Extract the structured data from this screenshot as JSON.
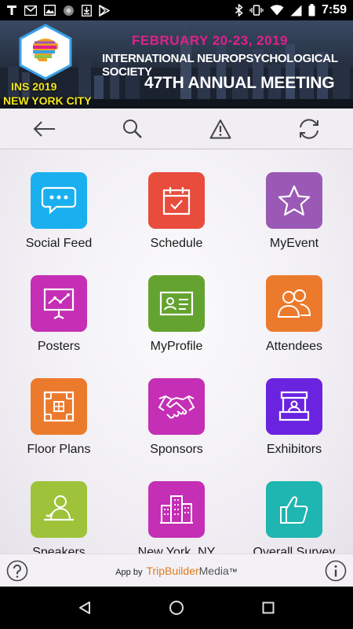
{
  "status_bar": {
    "time": "7:59",
    "icons": [
      "t-icon",
      "gmail-icon",
      "image-icon",
      "circle-icon",
      "download-icon",
      "play-store-icon",
      "bluetooth-icon",
      "vibrate-icon",
      "wifi-icon",
      "signal-icon",
      "battery-icon"
    ]
  },
  "banner": {
    "date": "FEBRUARY 20-23, 2019",
    "society": "INTERNATIONAL NEUROPSYCHOLOGICAL SOCIETY",
    "meeting": "47TH ANNUAL MEETING",
    "event_tag": "INS 2019",
    "city": "NEW YORK CITY"
  },
  "toolbar": {
    "buttons": [
      "back-arrow-icon",
      "search-icon",
      "alert-icon",
      "sync-icon"
    ]
  },
  "tiles": [
    {
      "label": "Social Feed",
      "icon": "chat-bubbles-icon",
      "color": "#1ab0f0"
    },
    {
      "label": "Schedule",
      "icon": "calendar-check-icon",
      "color": "#e84c3d"
    },
    {
      "label": "MyEvent",
      "icon": "star-icon",
      "color": "#9b59b6"
    },
    {
      "label": "Posters",
      "icon": "presentation-board-icon",
      "color": "#c42fb5"
    },
    {
      "label": "MyProfile",
      "icon": "id-card-icon",
      "color": "#64a330"
    },
    {
      "label": "Attendees",
      "icon": "people-icon",
      "color": "#ec7a2c"
    },
    {
      "label": "Floor Plans",
      "icon": "floor-plan-icon",
      "color": "#ec7a2c"
    },
    {
      "label": "Sponsors",
      "icon": "handshake-icon",
      "color": "#c42fb5"
    },
    {
      "label": "Exhibitors",
      "icon": "booth-icon",
      "color": "#6a24e0"
    },
    {
      "label": "Speakers",
      "icon": "speaker-podium-icon",
      "color": "#9ec33a"
    },
    {
      "label": "New York, NY",
      "icon": "city-buildings-icon",
      "color": "#c42fb5"
    },
    {
      "label": "Overall Survey",
      "icon": "thumbs-up-icon",
      "color": "#1fb5b0"
    }
  ],
  "footer": {
    "prefix": "App by",
    "brand_a": "TripBuilder",
    "brand_b": "Media",
    "trademark": "™"
  },
  "nav_bar": {
    "buttons": [
      "back-triangle-icon",
      "home-circle-icon",
      "recents-square-icon"
    ]
  }
}
